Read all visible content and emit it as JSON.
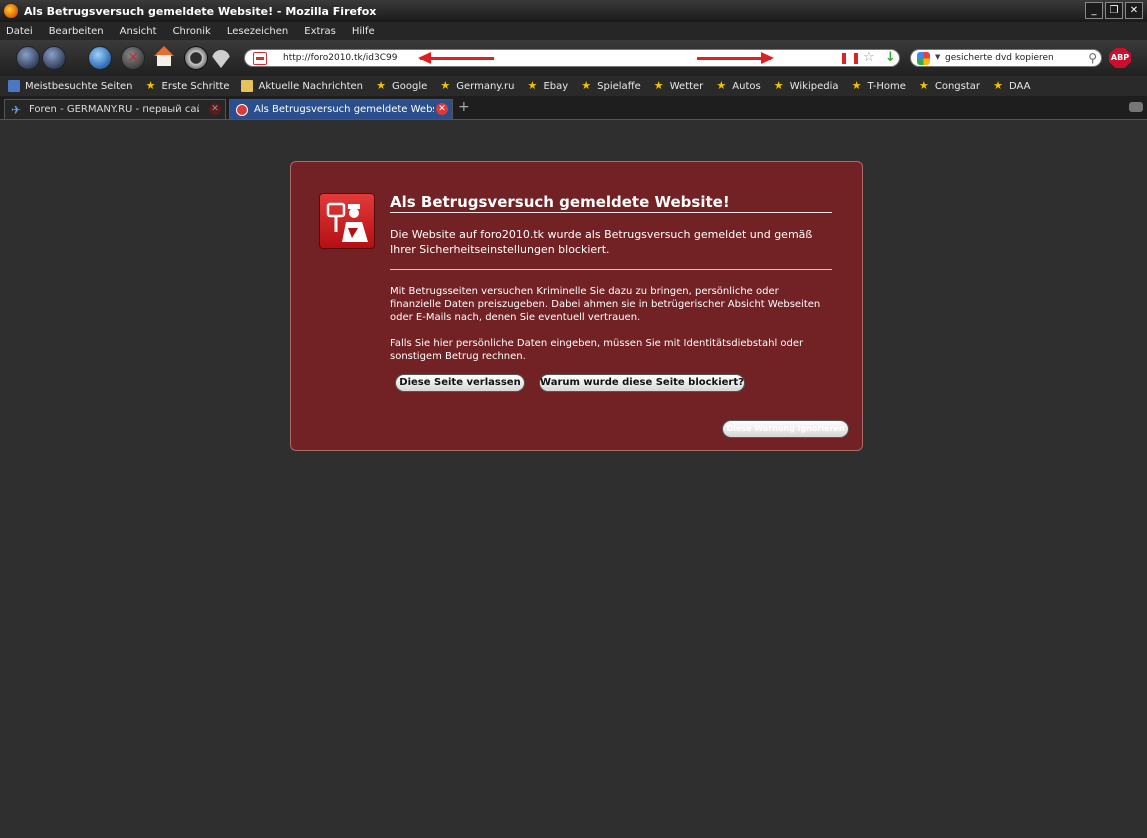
{
  "window": {
    "title": "Als Betrugsversuch gemeldete Website! - Mozilla Firefox",
    "controls": [
      "_",
      "❐",
      "✕"
    ]
  },
  "menu": [
    "Datei",
    "Bearbeiten",
    "Ansicht",
    "Chronik",
    "Lesezeichen",
    "Extras",
    "Hilfe"
  ],
  "navigation": {
    "url": "http://foro2010.tk/id3C99",
    "search_query": "gesicherte dvd kopieren",
    "abp_label": "ABP"
  },
  "bookmarks": [
    {
      "label": "Meistbesuchte Seiten",
      "icon": "folder-icon"
    },
    {
      "label": "Erste Schritte",
      "icon": "star-icon"
    },
    {
      "label": "Aktuelle Nachrichten",
      "icon": "rss-folder-icon"
    },
    {
      "label": "Google",
      "icon": "star-icon"
    },
    {
      "label": "Germany.ru",
      "icon": "star-icon"
    },
    {
      "label": "Ebay",
      "icon": "star-icon"
    },
    {
      "label": "Spielaffe",
      "icon": "star-icon"
    },
    {
      "label": "Wetter",
      "icon": "star-icon"
    },
    {
      "label": "Autos",
      "icon": "star-icon"
    },
    {
      "label": "Wikipedia",
      "icon": "star-icon"
    },
    {
      "label": "T-Home",
      "icon": "star-icon"
    },
    {
      "label": "Congstar",
      "icon": "star-icon"
    },
    {
      "label": "DAA",
      "icon": "star-icon"
    }
  ],
  "tabs": [
    {
      "label": "Foren - GERMANY.RU - первый сайт \"гд...",
      "active": false
    },
    {
      "label": "Als Betrugsversuch gemeldete Website!",
      "active": true
    }
  ],
  "warning": {
    "title": "Als Betrugsversuch gemeldete Website!",
    "short_desc": "Die Website auf foro2010.tk wurde als Betrugsversuch gemeldet und gemäß Ihrer Sicherheitseinstellungen blockiert.",
    "long_desc_1": "Mit Betrugsseiten versuchen Kriminelle Sie dazu zu bringen, persönliche oder finanzielle Daten preiszugeben. Dabei ahmen sie in betrügerischer Absicht Webseiten oder E-Mails nach, denen Sie eventuell vertrauen.",
    "long_desc_2": "Falls Sie hier persönliche Daten eingeben, müssen Sie mit Identitätsdiebstahl oder sonstigem Betrug rechnen.",
    "button_leave": "Diese Seite verlassen",
    "button_why": "Warum wurde diese Seite blockiert?",
    "button_ignore": "Diese Warnung ignorieren"
  },
  "colors": {
    "panel_bg": "#722224",
    "page_bg": "#2f2f2f",
    "annotation_arrow": "#e02020"
  }
}
